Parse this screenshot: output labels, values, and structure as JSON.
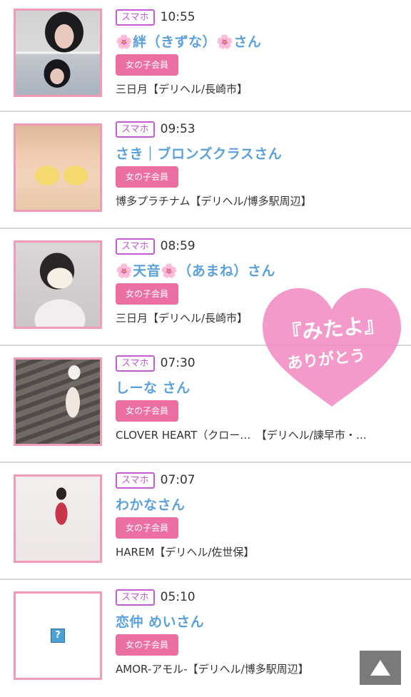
{
  "entries": [
    {
      "device": "スマホ",
      "time": "10:55",
      "name": "🌸絆（きずな）🌸さん",
      "member_label": "女の子会員",
      "shop": "三日月【デリヘル/長崎市】"
    },
    {
      "device": "スマホ",
      "time": "09:53",
      "name": "さき｜ブロンズクラスさん",
      "member_label": "女の子会員",
      "shop": "博多プラチナム【デリヘル/博多駅周辺】"
    },
    {
      "device": "スマホ",
      "time": "08:59",
      "name": "🌸天音🌸（あまね）さん",
      "member_label": "女の子会員",
      "shop": "三日月【デリヘル/長崎市】"
    },
    {
      "device": "スマホ",
      "time": "07:30",
      "name": "しーな さん",
      "member_label": "女の子会員",
      "shop": "CLOVER HEART（クロー…　【デリヘル/諫早市・…"
    },
    {
      "device": "スマホ",
      "time": "07:07",
      "name": "わかなさん",
      "member_label": "女の子会員",
      "shop": "HAREM【デリヘル/佐世保】"
    },
    {
      "device": "スマホ",
      "time": "05:10",
      "name": "恋仲 めいさん",
      "member_label": "女の子会員",
      "shop": "AMOR-アモル-【デリヘル/博多駅周辺】"
    }
  ],
  "stamp": {
    "line1": "『みたよ』",
    "line2": "ありがとう",
    "color": "#f28cc4"
  },
  "colors": {
    "name": "#5aa1dc",
    "badge": "#c55bd3",
    "member_bg": "#ec6fa4",
    "thumb_border": "#f39ab8"
  },
  "icons": {
    "scroll_top": "triangle-up-icon",
    "missing_image": "question-mark-icon"
  }
}
